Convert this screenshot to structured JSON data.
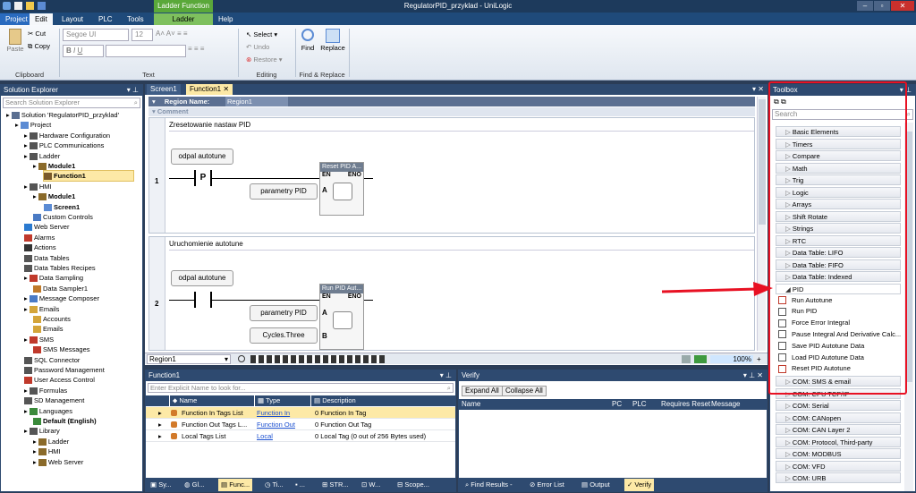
{
  "window": {
    "title": "RegulatorPID_przyklad - UniLogic",
    "ctx_tab": "Ladder Function"
  },
  "menu": {
    "tabs": [
      "Project",
      "Edit",
      "Layout",
      "PLC",
      "Tools",
      "Ladder",
      "Help"
    ]
  },
  "ribbon": {
    "clipboard": {
      "paste": "Paste",
      "cut": "Cut",
      "copy": "Copy",
      "label": "Clipboard"
    },
    "text": {
      "font": "Segoe UI",
      "size": "12",
      "label": "Text"
    },
    "editing": {
      "select": "Select",
      "undo": "Undo",
      "restore": "Restore",
      "label": "Editing"
    },
    "find": {
      "find": "Find",
      "replace": "Replace",
      "label": "Find & Replace"
    }
  },
  "solution_explorer": {
    "title": "Solution Explorer",
    "search_placeholder": "Search Solution Explorer",
    "items": [
      {
        "label": "Solution 'RegulatorPID_przyklad'",
        "bold": false
      },
      {
        "label": "Project",
        "bold": false
      },
      {
        "label": "Hardware Configuration",
        "bold": false
      },
      {
        "label": "PLC Communications",
        "bold": false
      },
      {
        "label": "Ladder",
        "bold": false
      },
      {
        "label": "Module1",
        "bold": true
      },
      {
        "label": "Function1",
        "bold": true
      },
      {
        "label": "HMI",
        "bold": false
      },
      {
        "label": "Module1",
        "bold": true
      },
      {
        "label": "Screen1",
        "bold": true
      },
      {
        "label": "Custom Controls",
        "bold": false
      },
      {
        "label": "Web Server",
        "bold": false
      },
      {
        "label": "Alarms",
        "bold": false
      },
      {
        "label": "Actions",
        "bold": false
      },
      {
        "label": "Data Tables",
        "bold": false
      },
      {
        "label": "Data Tables Recipes",
        "bold": false
      },
      {
        "label": "Data Sampling",
        "bold": false
      },
      {
        "label": "Data Sampler1",
        "bold": false
      },
      {
        "label": "Message Composer",
        "bold": false
      },
      {
        "label": "Emails",
        "bold": false
      },
      {
        "label": "Accounts",
        "bold": false
      },
      {
        "label": "Emails",
        "bold": false
      },
      {
        "label": "SMS",
        "bold": false
      },
      {
        "label": "SMS Messages",
        "bold": false
      },
      {
        "label": "SQL Connector",
        "bold": false
      },
      {
        "label": "Password Management",
        "bold": false
      },
      {
        "label": "User Access Control",
        "bold": false
      },
      {
        "label": "Formulas",
        "bold": false
      },
      {
        "label": "SD Management",
        "bold": false
      },
      {
        "label": "Languages",
        "bold": false
      },
      {
        "label": "Default (English)",
        "bold": true
      },
      {
        "label": "Library",
        "bold": false
      },
      {
        "label": "Ladder",
        "bold": false
      },
      {
        "label": "HMI",
        "bold": false
      },
      {
        "label": "Web Server",
        "bold": false
      }
    ]
  },
  "editor": {
    "tabs": [
      "Screen1",
      "Function1"
    ],
    "region_label": "Region Name:",
    "region_value": "Region1",
    "comment_label": "Comment",
    "rungs": [
      {
        "num": "1",
        "comment": "Zresetowanie nastaw PID",
        "contact_label": "odpal autotune",
        "contact": "P",
        "block": "Reset PID A...",
        "en": "EN",
        "eno": "ENO",
        "param_a": "parametry PID",
        "pin_a": "A"
      },
      {
        "num": "2",
        "comment": "Uruchomienie autotune",
        "contact_label": "odpal autotune",
        "block": "Run PID Aut...",
        "en": "EN",
        "eno": "ENO",
        "param_a": "parametry PID",
        "pin_a": "A",
        "param_b": "Cycles.Three",
        "pin_b": "B"
      }
    ],
    "status_region": "Region1",
    "zoom": "100%"
  },
  "function_panel": {
    "title": "Function1",
    "search_placeholder": "Enter Explicit Name to look for...",
    "columns": [
      "Name",
      "Type",
      "Description"
    ],
    "rows": [
      {
        "name": "Function In Tags List",
        "type": "Function In",
        "desc": "0 Function In Tag"
      },
      {
        "name": "Function Out Tags L...",
        "type": "Function Out",
        "desc": "0 Function Out Tag"
      },
      {
        "name": "Local Tags List",
        "type": "Local",
        "desc": "0 Local Tag (0 out of 256 Bytes used)"
      }
    ]
  },
  "verify_panel": {
    "title": "Verify",
    "expand": "Expand All",
    "collapse": "Collapse All",
    "columns": [
      "Name",
      "PC",
      "PLC",
      "Requires Reset",
      "Message"
    ]
  },
  "toolbox": {
    "title": "Toolbox",
    "search_placeholder": "Search",
    "categories": [
      "Basic Elements",
      "Timers",
      "Compare",
      "Math",
      "Trig",
      "Logic",
      "Arrays",
      "Shift Rotate",
      "Strings",
      "RTC",
      "Data Table: LIFO",
      "Data Table: FIFO",
      "Data Table: Indexed"
    ],
    "pid_label": "PID",
    "pid_items": [
      "Run Autotune",
      "Run PID",
      "Force Error Integral",
      "Pause Integral And Derivative Calc...",
      "Save PID Autotune Data",
      "Load PID Autotune Data",
      "Reset PID Autotune"
    ],
    "after": [
      "COM: SMS & email",
      "COM: CPU TCP/IP",
      "COM: Serial",
      "COM: CANopen",
      "COM: CAN Layer 2",
      "COM: Protocol, Third-party",
      "COM: MODBUS",
      "COM: VFD",
      "COM: URB",
      "COM: MQTT"
    ]
  },
  "bottom_tabs_left": [
    "Sy...",
    "Gl...",
    "Func...",
    "Ti...",
    "...",
    "STR...",
    "W...",
    "Scope..."
  ],
  "bottom_tabs_right": [
    "Find Results -",
    "Error List",
    "Output",
    "Verify"
  ],
  "colors": {
    "accent": "#e81123",
    "dark": "#2b3d57",
    "highlight": "#fde9a6"
  }
}
